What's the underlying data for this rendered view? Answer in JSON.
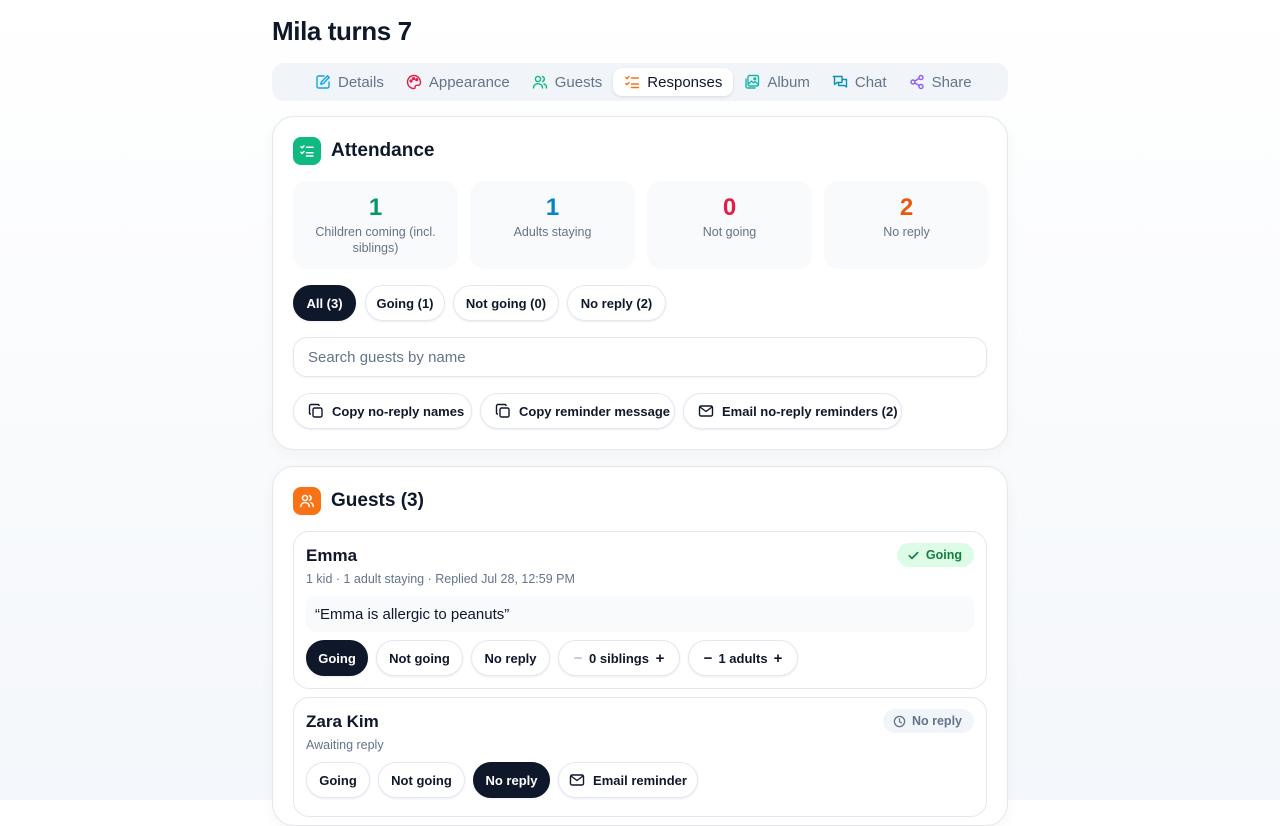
{
  "page": {
    "title": "Mila turns 7"
  },
  "tabs": [
    {
      "label": "Details",
      "icon": "edit-icon",
      "color": "#0ea5e9"
    },
    {
      "label": "Appearance",
      "icon": "palette-icon",
      "color": "#e11d48"
    },
    {
      "label": "Guests",
      "icon": "users-icon",
      "color": "#10b981"
    },
    {
      "label": "Responses",
      "icon": "list-check-icon",
      "color": "#f97316",
      "active": true
    },
    {
      "label": "Album",
      "icon": "images-icon",
      "color": "#14b8a6"
    },
    {
      "label": "Chat",
      "icon": "chat-icon",
      "color": "#0891b2"
    },
    {
      "label": "Share",
      "icon": "share-icon",
      "color": "#8b5cf6"
    }
  ],
  "attendance": {
    "title": "Attendance",
    "stats": [
      {
        "value": "1",
        "label": "Children coming (incl. siblings)",
        "color": "#059669"
      },
      {
        "value": "1",
        "label": "Adults staying",
        "color": "#0284c7"
      },
      {
        "value": "0",
        "label": "Not going",
        "color": "#e11d48"
      },
      {
        "value": "2",
        "label": "No reply",
        "color": "#ea580c"
      }
    ],
    "filters": [
      {
        "label": "All (3)",
        "active": true
      },
      {
        "label": "Going (1)"
      },
      {
        "label": "Not going (0)"
      },
      {
        "label": "No reply (2)"
      }
    ],
    "search_placeholder": "Search guests by name",
    "actions": [
      {
        "label": "Copy no-reply names",
        "icon": "copy-icon"
      },
      {
        "label": "Copy reminder message",
        "icon": "copy-icon"
      },
      {
        "label": "Email no-reply reminders (2)",
        "icon": "mail-icon"
      }
    ]
  },
  "guests": {
    "title": "Guests (3)",
    "list": [
      {
        "name": "Emma",
        "meta": "1 kid · 1 adult staying · Replied Jul 28, 12:59 PM",
        "status": "Going",
        "status_icon": "check-icon",
        "note": "“Emma is allergic to peanuts”",
        "buttons": [
          "Going",
          "Not going",
          "No reply"
        ],
        "active_button": "Going",
        "siblings_label": "0 siblings",
        "adults_label": "1 adults"
      },
      {
        "name": "Zara Kim",
        "meta": "Awaiting reply",
        "status": "No reply",
        "status_icon": "clock-icon",
        "buttons": [
          "Going",
          "Not going",
          "No reply"
        ],
        "active_button": "No reply",
        "email_label": "Email reminder"
      }
    ]
  },
  "colors": {
    "accent_dark": "#0f172a",
    "going_bg": "#dcfce7",
    "going_text": "#15803d",
    "noreply_bg": "#f1f5f9",
    "noreply_text": "#64748b"
  }
}
